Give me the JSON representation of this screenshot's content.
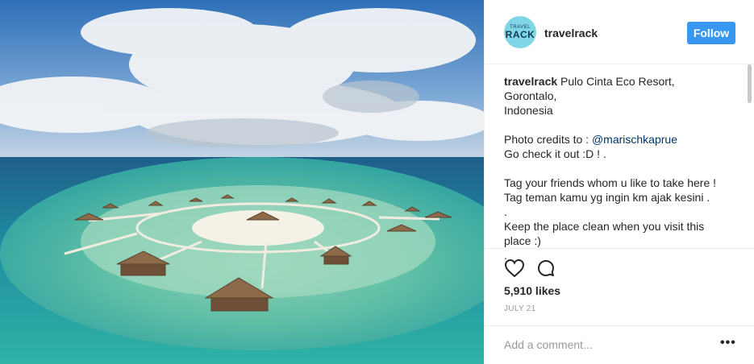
{
  "post": {
    "image_alt": "Aerial view of overwater resort huts on turquoise sea",
    "username": "travelrack",
    "avatar_text_top": "TRAVEL",
    "avatar_text_main": "RACK",
    "follow_label": "Follow"
  },
  "caption": {
    "username": "travelrack",
    "lines": [
      " Pulo Cinta Eco Resort, Gorontalo,",
      "Indonesia",
      "",
      "Photo credits to : ",
      "Go check it out :D ! .",
      "",
      "Tag your friends whom u like to take here !",
      "Tag teman kamu yg ingin km ajak kesini .",
      ".",
      "Keep the place clean when you visit this",
      "place :)",
      "."
    ],
    "mention": "@marischkaprue"
  },
  "actions": {
    "like_icon": "heart-icon",
    "comment_icon": "comment-icon"
  },
  "likes": "5,910 likes",
  "date": "JULY 21",
  "comment": {
    "placeholder": "Add a comment...",
    "more": "•••"
  },
  "colors": {
    "follow_bg": "#3897f0",
    "border": "#efefef",
    "muted": "#999999"
  }
}
